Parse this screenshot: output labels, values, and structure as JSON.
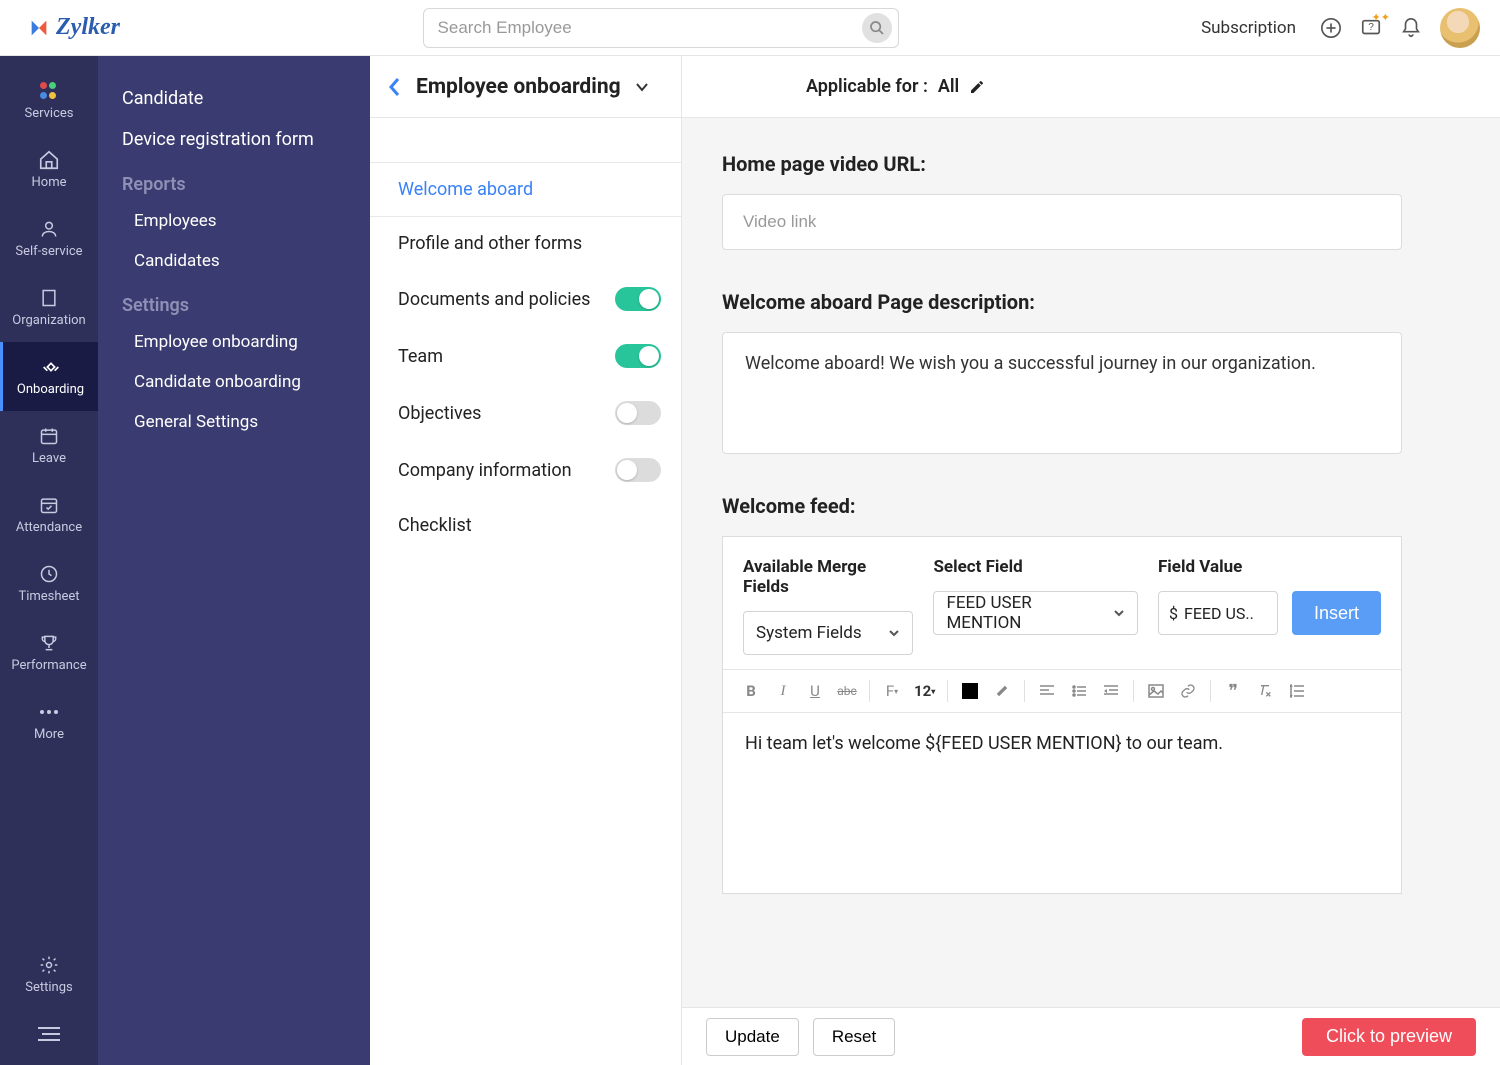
{
  "brand": "Zylker",
  "search_placeholder": "Search Employee",
  "header": {
    "subscription": "Subscription"
  },
  "nav_thin": {
    "services": "Services",
    "home": "Home",
    "self_service": "Self-service",
    "organization": "Organization",
    "onboarding": "Onboarding",
    "leave": "Leave",
    "attendance": "Attendance",
    "timesheet": "Timesheet",
    "performance": "Performance",
    "more": "More",
    "settings": "Settings"
  },
  "nav_sec": {
    "candidate": "Candidate",
    "device_reg": "Device registration form",
    "reports": "Reports",
    "employees": "Employees",
    "candidates": "Candidates",
    "settings": "Settings",
    "emp_onboarding": "Employee onboarding",
    "cand_onboarding": "Candidate onboarding",
    "general_settings": "General Settings"
  },
  "settings_col": {
    "title": "Employee onboarding",
    "items": {
      "welcome": "Welcome aboard",
      "profile": "Profile and other forms",
      "docs": "Documents and policies",
      "team": "Team",
      "objectives": "Objectives",
      "company": "Company information",
      "checklist": "Checklist"
    }
  },
  "main": {
    "applicable_prefix": "Applicable for :",
    "applicable_value": "All",
    "video_label": "Home page video URL:",
    "video_placeholder": "Video link",
    "desc_label": "Welcome aboard Page description:",
    "desc_value": "Welcome aboard! We wish you a successful journey in our organization.",
    "feed_label": "Welcome feed:",
    "merge_fields_label": "Available Merge Fields",
    "merge_fields_value": "System Fields",
    "select_field_label": "Select Field",
    "select_field_value": "FEED USER MENTION",
    "field_value_label": "Field Value",
    "field_value_value": "FEED US..",
    "insert": "Insert",
    "font_size": "12",
    "editor_text": "Hi team let's welcome ${FEED USER MENTION} to our team."
  },
  "footer": {
    "update": "Update",
    "reset": "Reset",
    "preview": "Click to preview"
  }
}
